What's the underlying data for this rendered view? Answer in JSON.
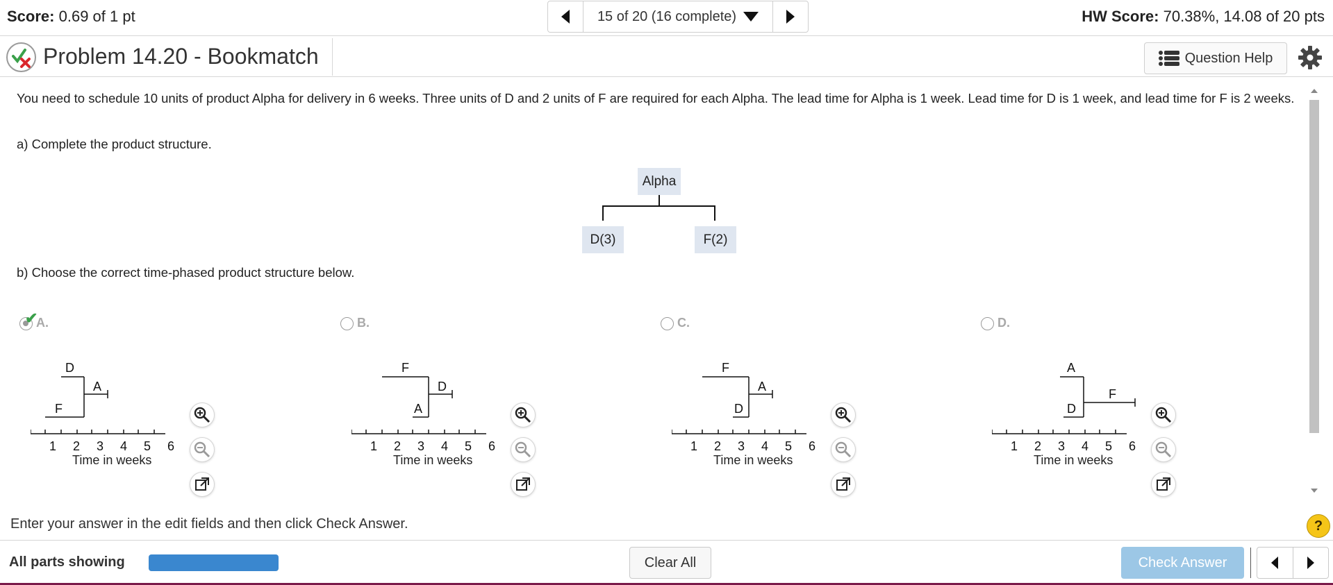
{
  "header": {
    "score_label": "Score:",
    "score_value": "0.69 of 1 pt",
    "nav_position": "15 of 20 (16 complete)",
    "hw_score_label": "HW Score:",
    "hw_score_value": "70.38%, 14.08 of 20 pts"
  },
  "title": {
    "problem_title": "Problem 14.20 - Bookmatch",
    "question_help": "Question Help"
  },
  "question": {
    "text": "You need to schedule 10 units of product Alpha for delivery in 6 weeks. Three units of D and 2 units of F are required for each Alpha. The lead time for Alpha is 1 week. Lead time for D is 1 week, and lead time for F is 2 weeks.",
    "part_a": "a) Complete the product structure.",
    "part_b": "b) Choose the correct time-phased product structure below.",
    "tree": {
      "root": "Alpha",
      "left": "D(3)",
      "right": "F(2)"
    }
  },
  "options": [
    {
      "label": "A.",
      "selected": true,
      "upper": "D",
      "lower": "F",
      "parent": "A"
    },
    {
      "label": "B.",
      "selected": false,
      "upper": "F",
      "lower": "A",
      "parent": "D"
    },
    {
      "label": "C.",
      "selected": false,
      "upper": "F",
      "lower": "D",
      "parent": "A"
    },
    {
      "label": "D.",
      "selected": false,
      "upper": "A",
      "lower": "D",
      "parent": "F"
    }
  ],
  "axis": {
    "ticks": [
      "1",
      "2",
      "3",
      "4",
      "5",
      "6"
    ],
    "label": "Time in weeks"
  },
  "footer": {
    "instruction": "Enter your answer in the edit fields and then click Check Answer.",
    "all_parts": "All parts showing",
    "clear_all": "Clear All",
    "check_answer": "Check Answer",
    "help": "?"
  },
  "colors": {
    "progress": "#3a87cf",
    "check_answer_bg": "#9cc7e6",
    "tree_node_bg": "#dfe6f0",
    "correct_check": "#3aa04a",
    "incorrect_x": "#d9262c"
  }
}
